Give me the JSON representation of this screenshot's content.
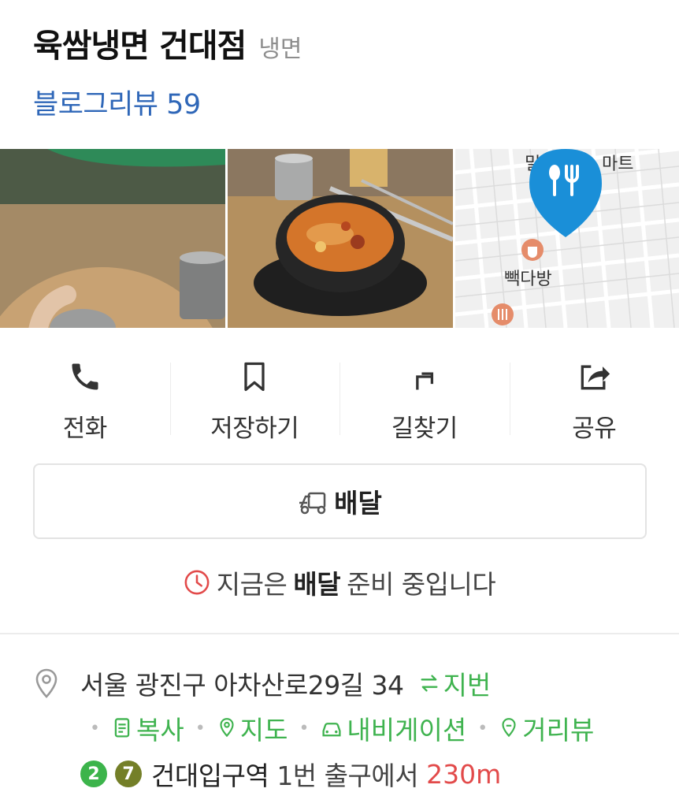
{
  "place": {
    "name": "육쌈냉면 건대점",
    "category": "냉면",
    "blog_review_label": "블로그리뷰",
    "blog_review_count": "59"
  },
  "photos": [
    {
      "name": "naengmyeon-photo"
    },
    {
      "name": "stew-photo"
    },
    {
      "name": "map-thumbnail",
      "map_labels": [
        "밀",
        "마트",
        "빽다방"
      ]
    }
  ],
  "actions": [
    {
      "label": "전화",
      "icon": "phone-icon"
    },
    {
      "label": "저장하기",
      "icon": "bookmark-icon"
    },
    {
      "label": "길찾기",
      "icon": "directions-icon"
    },
    {
      "label": "공유",
      "icon": "share-icon"
    }
  ],
  "delivery": {
    "button_label": "배달",
    "notice_prefix": "지금은",
    "notice_bold": "배달",
    "notice_suffix": "준비 중입니다"
  },
  "address": {
    "text": "서울 광진구 아차산로29길 34",
    "jibun_label": "지번",
    "links": [
      {
        "label": "복사",
        "icon": "copy-icon"
      },
      {
        "label": "지도",
        "icon": "map-pin-icon"
      },
      {
        "label": "내비게이션",
        "icon": "car-icon"
      },
      {
        "label": "거리뷰",
        "icon": "street-view-icon"
      }
    ]
  },
  "station": {
    "lines": [
      {
        "number": "2",
        "color": "#3cb44b"
      },
      {
        "number": "7",
        "color": "#747f28"
      }
    ],
    "name": "건대입구역",
    "exit_text": "1번 출구에서",
    "distance": "230m"
  },
  "colors": {
    "link_blue": "#2f67b8",
    "green": "#3fb34f",
    "red": "#e24a4a",
    "map_pin": "#1a8fd8"
  }
}
